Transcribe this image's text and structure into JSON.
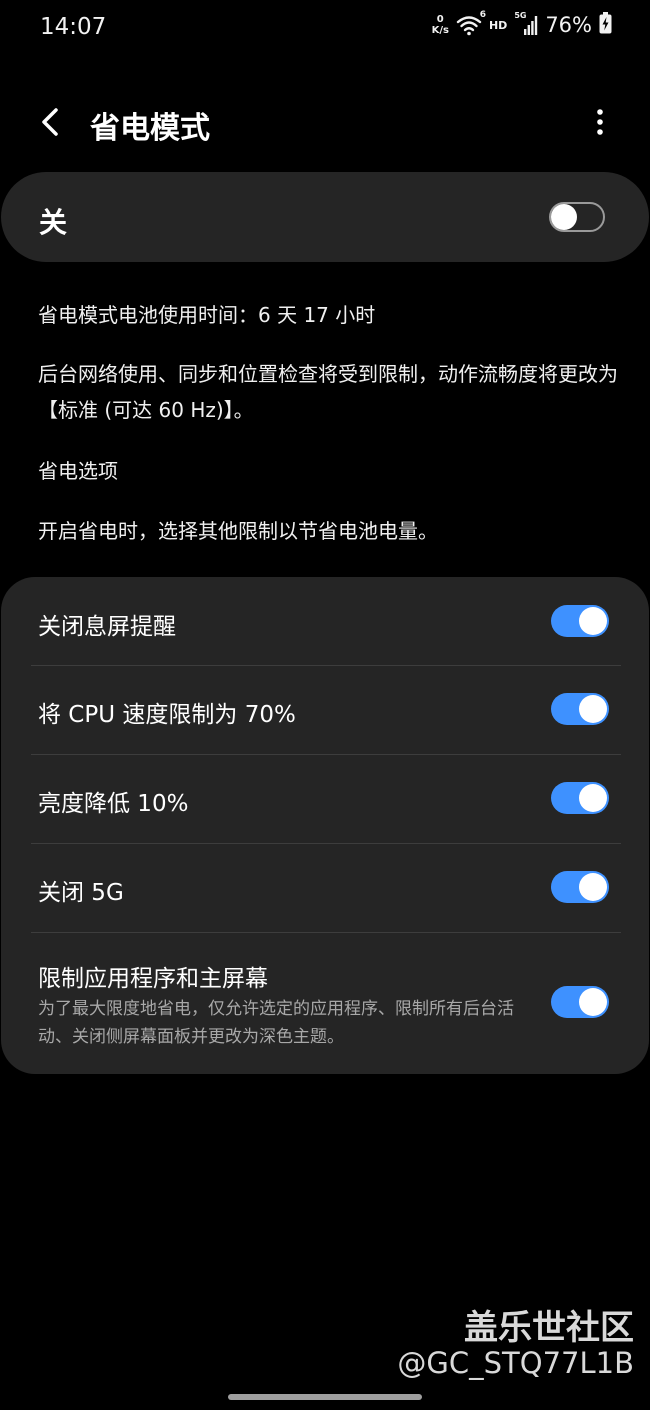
{
  "status_bar": {
    "time": "14:07",
    "net_speed_value": "0",
    "net_speed_unit": "K/s",
    "wifi_badge": "6",
    "hd": "HD",
    "signal_badge": "5G",
    "battery": "76%"
  },
  "header": {
    "title": "省电模式"
  },
  "master": {
    "label": "关",
    "enabled": false
  },
  "info": {
    "battery_time": "省电模式电池使用时间：6 天 17 小时",
    "restriction_note": "后台网络使用、同步和位置检查将受到限制，动作流畅度将更改为【标准 (可达 60 Hz)】。",
    "options_heading": "省电选项",
    "options_note": "开启省电时，选择其他限制以节省电池电量。"
  },
  "options": [
    {
      "label": "关闭息屏提醒",
      "enabled": true
    },
    {
      "label": "将 CPU 速度限制为 70%",
      "enabled": true
    },
    {
      "label": "亮度降低 10%",
      "enabled": true
    },
    {
      "label": "关闭 5G",
      "enabled": true
    },
    {
      "label": "限制应用程序和主屏幕",
      "sub": "为了最大限度地省电，仅允许选定的应用程序、限制所有后台活动、关闭侧屏幕面板并更改为深色主题。",
      "enabled": true
    }
  ],
  "watermark": {
    "line1": "盖乐世社区",
    "line2": "@GC_STQ77L1B"
  },
  "colors": {
    "accent": "#3e91ff",
    "card": "#252525",
    "background": "#000000"
  }
}
